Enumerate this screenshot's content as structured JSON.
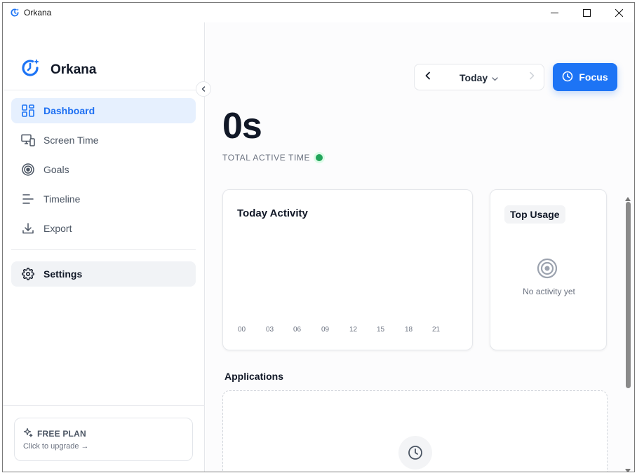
{
  "window": {
    "title": "Orkana",
    "controls": [
      "minimize",
      "maximize",
      "close"
    ]
  },
  "sidebar": {
    "brand": "Orkana",
    "items": [
      {
        "label": "Dashboard",
        "icon": "dashboard-grid-icon",
        "active": true
      },
      {
        "label": "Screen Time",
        "icon": "screen-time-icon",
        "active": false
      },
      {
        "label": "Goals",
        "icon": "target-icon",
        "active": false
      },
      {
        "label": "Timeline",
        "icon": "timeline-lines-icon",
        "active": false
      },
      {
        "label": "Export",
        "icon": "download-icon",
        "active": false
      }
    ],
    "settings": {
      "label": "Settings",
      "icon": "gear-icon"
    },
    "plan": {
      "title": "FREE PLAN",
      "subtitle": "Click to upgrade →",
      "icon": "sparkles-icon"
    }
  },
  "header": {
    "date_label": "Today",
    "focus_label": "Focus"
  },
  "summary": {
    "total_time": "0s",
    "label": "TOTAL ACTIVE TIME",
    "status_color": "#22a55b"
  },
  "activity": {
    "title": "Today Activity",
    "hours": [
      "00",
      "03",
      "06",
      "09",
      "12",
      "15",
      "18",
      "21"
    ]
  },
  "top_usage": {
    "title": "Top Usage",
    "empty_text": "No activity yet"
  },
  "applications": {
    "title": "Applications"
  },
  "colors": {
    "accent": "#1d74f5",
    "active_bg": "#e6f0fe",
    "status": "#22a55b"
  }
}
